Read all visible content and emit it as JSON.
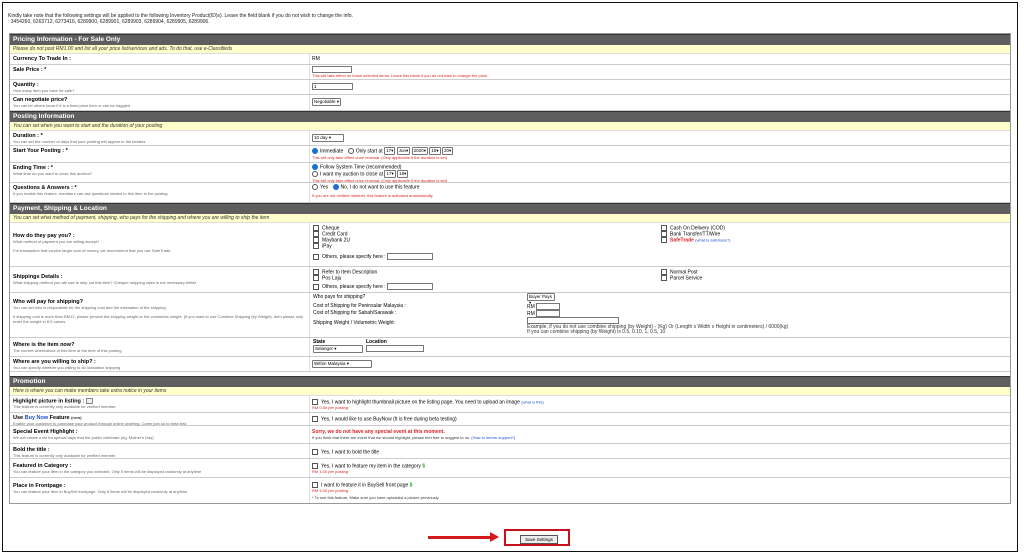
{
  "intro": {
    "line1": "Kindly take note that the following settings will be applied to the following Inventory Product(ID)s). Leave the field blank if you do not wish to change the info.",
    "line2": ": 3454260, 6263712, 6273416, 6289900, 6289901, 6289903, 6289904, 6289905, 6289906."
  },
  "pricing": {
    "header": "Pricing Information - For Sale Only",
    "note": "Please do not post RM1.00 and list all your price list/services and ads. To do that, use e-Classifieds",
    "currency_label": "Currency To Trade In :",
    "currency_value": "RM",
    "sale_price_label": "Sale Price : *",
    "sale_price_note": "This will take effect on those selected items. Leave this blank if you do not wish to change the price.",
    "quantity_label": "Quantity :",
    "quantity_hint": "How many item you have for sale?",
    "quantity_value": "1",
    "negotiate_label": "Can negotiate price?",
    "negotiate_hint": "You can let others know if it is a fixed price item or can be haggled",
    "negotiate_value": "Negotiable"
  },
  "posting": {
    "header": "Posting Information",
    "note": "You can set when you want to start and the duration of your posting",
    "duration_label": "Duration : *",
    "duration_hint": "You can set the number of days that your posting will appear to the bidders",
    "duration_value": "10 day",
    "start_label": "Start Your Posting : *",
    "start_immediate": "Immediate",
    "start_only": "Only start at",
    "start_day": "17",
    "start_month": "Jun",
    "start_year": "2020",
    "start_hour": "18",
    "start_min": "20",
    "start_note": "This will only take effect once renewal. (Only applicable if the duration is set)",
    "ending_label": "Ending Time : *",
    "ending_hint": "What time do you want to close this auction?",
    "ending_follow": "Follow System Time (recommended)",
    "ending_want": "I want my auction to close at",
    "ending_hour": "17",
    "ending_min": "18",
    "ending_note": "This will only take effect once renewal. (Only applicable if the duration is set)",
    "qa_label": "Questions & Answers : *",
    "qa_hint": "If you enable this feature, members can ask questions related to this item in the posting",
    "qa_yes": "Yes",
    "qa_no": "No, I do not want to use this feature",
    "qa_note": "If you are not verified member, this feature is activated automatically."
  },
  "payment": {
    "header": "Payment, Shipping & Location",
    "note": "You can set what method of payment, shipping, who pays for the shipping and where you are willing to ship the item",
    "pay_label": "How do they pay you? :",
    "pay_hint": "What method of payment you are willing accept?",
    "pay_hint2": "For transaction that involve larger sum of money, we recommend that you use SafeTrade.",
    "options": [
      "Cheque",
      "Credit Card",
      "Maybank 2U",
      "iPay",
      "Cash On Delivery (COD)",
      "Bank Transfer/TT/Wire",
      "SafeTrade"
    ],
    "safetrade_link": "(what is safetrade?)",
    "others": "Others, please specify here :",
    "ship_label": "Shippings Details :",
    "ship_hint": "What shipping method you will use to ship out this item? Cheaper shipping rates is not necessary better",
    "ship_options": [
      "Refer to Item Description",
      "Pos Laju",
      "Normal Post",
      "Parcel Service"
    ],
    "who_label": "Who will pay for shipping?",
    "who_hint": "You can set who is responsible for the shipping cost and the estimation of the shipping.",
    "who_hint2": "If shipping cost is more than RM12, please provide the shipping weight or the volumetric weight. (If you want to use Combine Shipping (by Weight), then please only enter the weight in KG values.",
    "who_pays_q": "Who pays for shipping?",
    "who_pays_value": "Buyer Pays",
    "cost_pen": "Cost of Shipping for Peninsular Malaysia :",
    "cost_sab": "Cost of Shipping for Sabah/Sarawak :",
    "rm": "RM",
    "ship_weight": "Shipping Weight / Volumetric Weight:",
    "weight_note1": "Example, if you do not use combine shipping (by Weight) - (Kg) Or (Length x Width x Height in centimeters) / 6000(kg)",
    "weight_note2": "If you can combine shipping (by Weight) is 0.5, 0.10, 1, 0.5, 10",
    "item_now_label": "Where is the item now?",
    "item_now_hint": "The current whereabout of this item at the time of this posting",
    "state_label": "State",
    "location_label": "Location",
    "state_value": "Selangor",
    "ship_where_label": "Where are you willing to ship? :",
    "ship_where_hint": "You can specify whether you willing to do outstation shipping",
    "ship_where_value": "Within Malaysia"
  },
  "promotion": {
    "header": "Promotion",
    "note": "Here is where you can make members take extra notice in your items",
    "highlight_label": "Highlight picture in listing :",
    "highlight_hint": "This feature is currently only available for verified member.",
    "highlight_text": "Yes, I want to highlight thumbnail picture on the listing page. You need to upload an image",
    "highlight_link": "(what is this)",
    "highlight_price": "RM 0.50 per posting",
    "buynow_label_a": "Use ",
    "buynow_label_b": "Buy Now",
    "buynow_label_c": " Feature",
    "buynow_tag": "(new)",
    "buynow_hint": "Enable your customer to purchase your product through online ordering. Come join us to beta test.",
    "buynow_text": "Yes, I would like to use BuyNow",
    "buynow_free": "(It is free during beta testing)",
    "special_label": "Special Event Highlight :",
    "special_hint": "We will create a list for special days that the public celebrate (eg. Mother's Day)",
    "special_red": "Sorry, we do not have any special event at this moment.",
    "special_note": "If you think that there are event that we should highlight, please feel free to suggest to us.",
    "special_link": "(How to inform support?)",
    "bold_label": "Bold the title :",
    "bold_hint": "This feature is currently only available for verified member.",
    "bold_text": "Yes, I want to bold the title",
    "featured_label": "Featured in Category :",
    "featured_hint": "You can feature your item in the category you selected. Only 5 items will be displayed randomly at anytime",
    "featured_text": "Yes, I want to feature my item in the category",
    "featured_price": "RM 1.00 per posting",
    "front_label": "Place in Frontpage :",
    "front_hint": "You can feature your item in BuySell frontpage. Only 8 items will be displayed randomly at anytime",
    "front_text": "I want to feature it in BuySell front page",
    "front_price": "RM 4.00 per posting",
    "front_note": "* To use this feature, Make sure you have uploaded a picture previously"
  },
  "save_label": "Save Settings",
  "colors": {
    "header_bg": "#5e5e5e",
    "note_bg": "#ffffcc",
    "arrow": "#d21a1a"
  }
}
